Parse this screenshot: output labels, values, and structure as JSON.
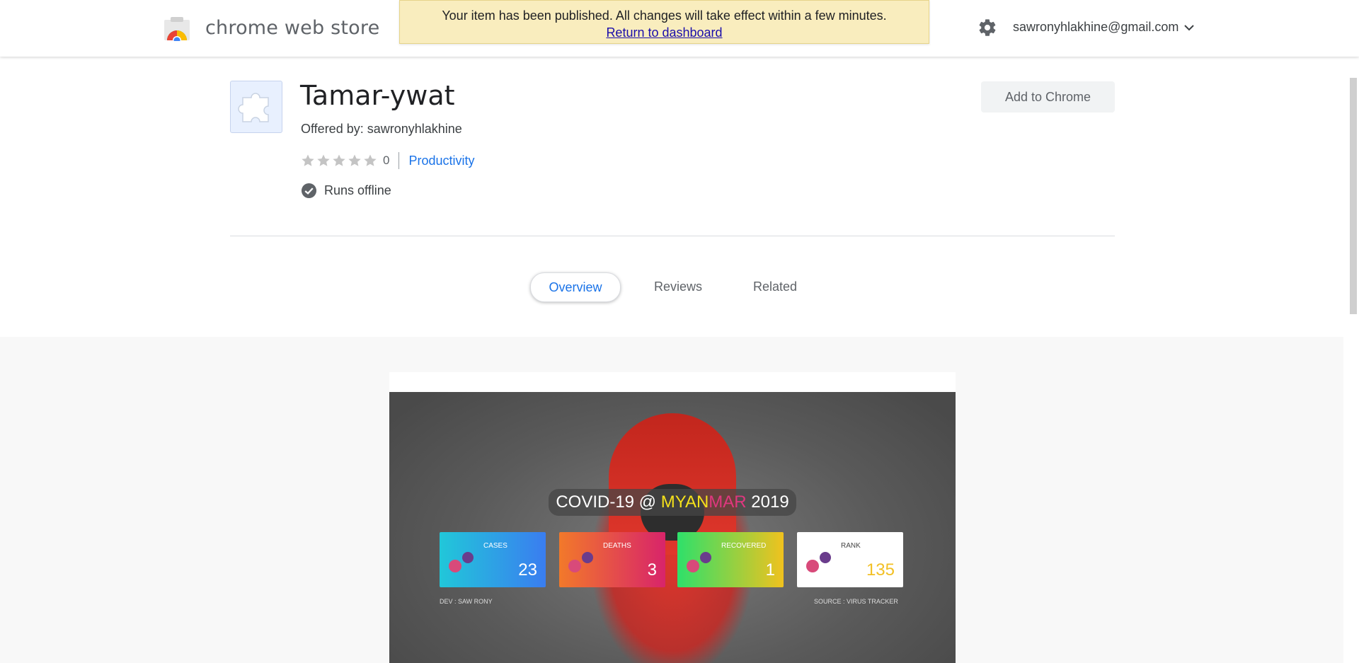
{
  "header": {
    "brand": "chrome web store",
    "account_email": "sawronyhlakhine@gmail.com"
  },
  "notice": {
    "message": "Your item has been published. All changes will take effect within a few minutes.",
    "link": "Return to dashboard"
  },
  "item": {
    "title": "Tamar-ywat",
    "offered_by": "Offered by: sawronyhlakhine",
    "rating_value": 0,
    "rating_count": "0",
    "category": "Productivity",
    "feature": "Runs offline",
    "add_button": "Add to Chrome"
  },
  "tabs": [
    {
      "label": "Overview",
      "active": true
    },
    {
      "label": "Reviews",
      "active": false
    },
    {
      "label": "Related",
      "active": false
    }
  ],
  "screenshot": {
    "title_part1": "COVID-19 @ ",
    "title_part2": "MYAN",
    "title_part3": "MAR",
    "title_part4": " 2019",
    "cards": [
      {
        "label": "CASES",
        "value": "23"
      },
      {
        "label": "DEATHS",
        "value": "3"
      },
      {
        "label": "RECOVERED",
        "value": "1"
      },
      {
        "label": "RANK",
        "value": "135"
      }
    ],
    "footer_left": "DEV : SAW RONY",
    "footer_right": "SOURCE : VIRUS TRACKER"
  },
  "colors": {
    "accent": "#1a73e8",
    "notice_bg": "#f9edbe",
    "link": "#1a0dab"
  }
}
